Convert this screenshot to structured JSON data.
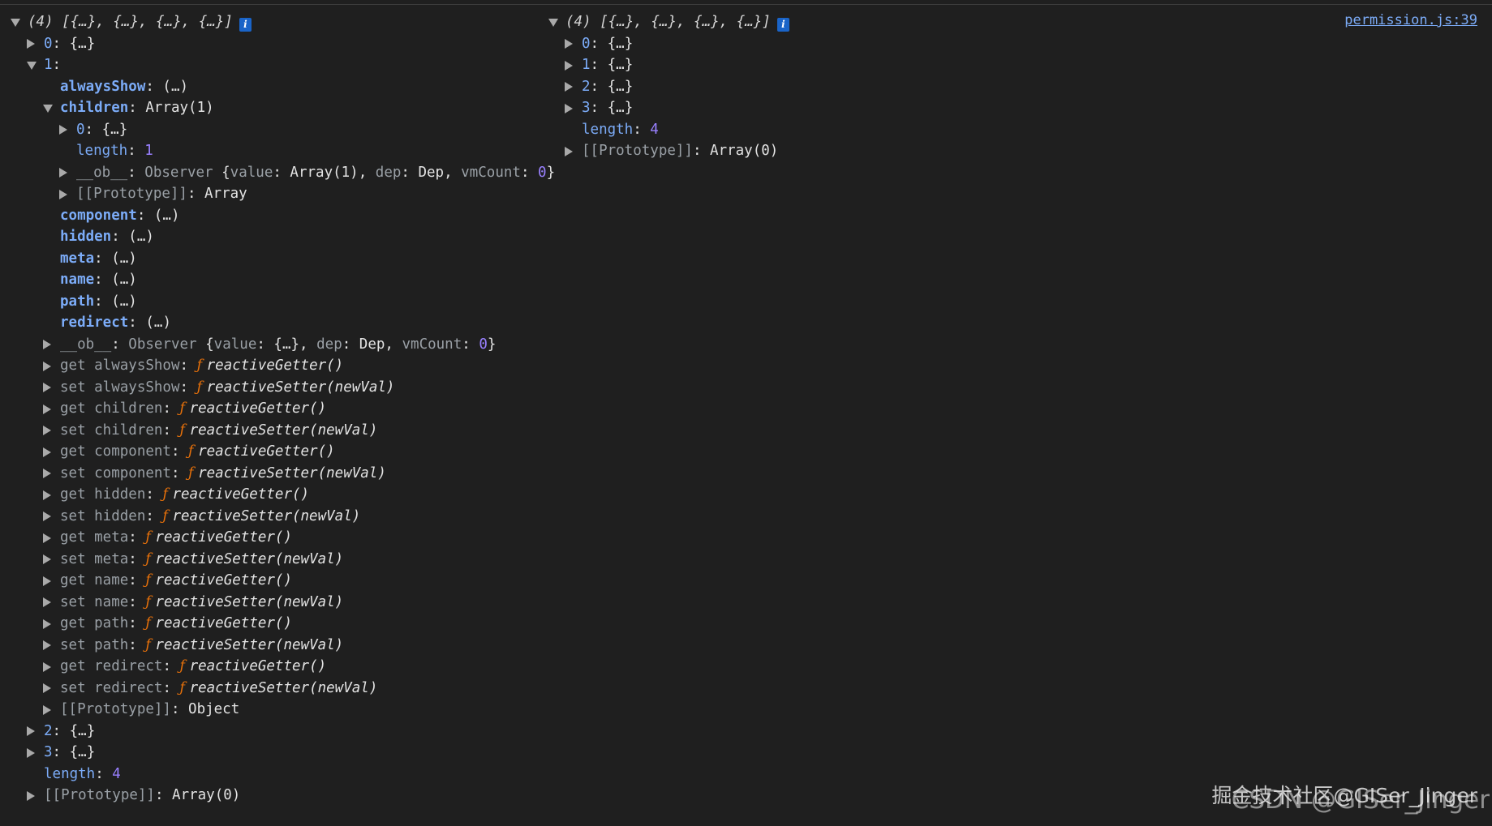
{
  "console": {
    "source_link": "permission.js:39",
    "watermark_primary": "掘金技术社区@GISer_Jinger",
    "watermark_secondary": "CSDN @GISer_Jinger",
    "left_tree": [
      {
        "indent": 0,
        "toggle": "down",
        "parts": [
          {
            "t": "(4)  [{…}, {…}, {…}, {…}]",
            "c": "sum"
          }
        ],
        "info": true
      },
      {
        "indent": 1,
        "toggle": "right",
        "parts": [
          {
            "t": "0",
            "c": "k"
          },
          {
            "t": ": {…}",
            "c": "val"
          }
        ]
      },
      {
        "indent": 1,
        "toggle": "down",
        "parts": [
          {
            "t": "1",
            "c": "k"
          },
          {
            "t": ":",
            "c": "val"
          }
        ]
      },
      {
        "indent": 2,
        "toggle": "none",
        "parts": [
          {
            "t": "alwaysShow",
            "c": "kb"
          },
          {
            "t": ":  (…)",
            "c": "val"
          }
        ]
      },
      {
        "indent": 2,
        "toggle": "down",
        "parts": [
          {
            "t": "children",
            "c": "kb"
          },
          {
            "t": ": Array(1)",
            "c": "val"
          }
        ]
      },
      {
        "indent": 3,
        "toggle": "right",
        "parts": [
          {
            "t": "0",
            "c": "k"
          },
          {
            "t": ": {…}",
            "c": "val"
          }
        ]
      },
      {
        "indent": 3,
        "toggle": "none",
        "parts": [
          {
            "t": "length",
            "c": "k"
          },
          {
            "t": ": ",
            "c": "val"
          },
          {
            "t": "1",
            "c": "num"
          }
        ]
      },
      {
        "indent": 3,
        "toggle": "right",
        "parts": [
          {
            "t": "__ob__",
            "c": "kd"
          },
          {
            "t": ": ",
            "c": "val"
          },
          {
            "t": "Observer  ",
            "c": "kd"
          },
          {
            "t": "{",
            "c": "val"
          },
          {
            "t": "value",
            "c": "kd"
          },
          {
            "t": ": Array(1), ",
            "c": "val"
          },
          {
            "t": "dep",
            "c": "kd"
          },
          {
            "t": ": Dep, ",
            "c": "val"
          },
          {
            "t": "vmCount",
            "c": "kd"
          },
          {
            "t": ": ",
            "c": "val"
          },
          {
            "t": "0",
            "c": "num"
          },
          {
            "t": "}",
            "c": "val"
          }
        ]
      },
      {
        "indent": 3,
        "toggle": "right",
        "parts": [
          {
            "t": "[[Prototype]]",
            "c": "kd"
          },
          {
            "t": ": Array",
            "c": "val"
          }
        ]
      },
      {
        "indent": 2,
        "toggle": "none",
        "parts": [
          {
            "t": "component",
            "c": "kb"
          },
          {
            "t": ":  (…)",
            "c": "val"
          }
        ]
      },
      {
        "indent": 2,
        "toggle": "none",
        "parts": [
          {
            "t": "hidden",
            "c": "kb"
          },
          {
            "t": ":  (…)",
            "c": "val"
          }
        ]
      },
      {
        "indent": 2,
        "toggle": "none",
        "parts": [
          {
            "t": "meta",
            "c": "kb"
          },
          {
            "t": ":  (…)",
            "c": "val"
          }
        ]
      },
      {
        "indent": 2,
        "toggle": "none",
        "parts": [
          {
            "t": "name",
            "c": "kb"
          },
          {
            "t": ":  (…)",
            "c": "val"
          }
        ]
      },
      {
        "indent": 2,
        "toggle": "none",
        "parts": [
          {
            "t": "path",
            "c": "kb"
          },
          {
            "t": ":  (…)",
            "c": "val"
          }
        ]
      },
      {
        "indent": 2,
        "toggle": "none",
        "parts": [
          {
            "t": "redirect",
            "c": "kb"
          },
          {
            "t": ":  (…)",
            "c": "val"
          }
        ]
      },
      {
        "indent": 2,
        "toggle": "right",
        "parts": [
          {
            "t": "__ob__",
            "c": "kd"
          },
          {
            "t": ": ",
            "c": "val"
          },
          {
            "t": "Observer  ",
            "c": "kd"
          },
          {
            "t": "{",
            "c": "val"
          },
          {
            "t": "value",
            "c": "kd"
          },
          {
            "t": ": {…}, ",
            "c": "val"
          },
          {
            "t": "dep",
            "c": "kd"
          },
          {
            "t": ": Dep, ",
            "c": "val"
          },
          {
            "t": "vmCount",
            "c": "kd"
          },
          {
            "t": ": ",
            "c": "val"
          },
          {
            "t": "0",
            "c": "num"
          },
          {
            "t": "}",
            "c": "val"
          }
        ]
      },
      {
        "indent": 2,
        "toggle": "right",
        "parts": [
          {
            "t": "get alwaysShow",
            "c": "kd"
          },
          {
            "t": ": ",
            "c": "val"
          },
          {
            "t": "ƒ ",
            "c": "f"
          },
          {
            "t": "reactiveGetter()",
            "c": "fn"
          }
        ]
      },
      {
        "indent": 2,
        "toggle": "right",
        "parts": [
          {
            "t": "set alwaysShow",
            "c": "kd"
          },
          {
            "t": ": ",
            "c": "val"
          },
          {
            "t": "ƒ ",
            "c": "f"
          },
          {
            "t": "reactiveSetter(newVal)",
            "c": "fn"
          }
        ]
      },
      {
        "indent": 2,
        "toggle": "right",
        "parts": [
          {
            "t": "get children",
            "c": "kd"
          },
          {
            "t": ": ",
            "c": "val"
          },
          {
            "t": "ƒ ",
            "c": "f"
          },
          {
            "t": "reactiveGetter()",
            "c": "fn"
          }
        ]
      },
      {
        "indent": 2,
        "toggle": "right",
        "parts": [
          {
            "t": "set children",
            "c": "kd"
          },
          {
            "t": ": ",
            "c": "val"
          },
          {
            "t": "ƒ ",
            "c": "f"
          },
          {
            "t": "reactiveSetter(newVal)",
            "c": "fn"
          }
        ]
      },
      {
        "indent": 2,
        "toggle": "right",
        "parts": [
          {
            "t": "get component",
            "c": "kd"
          },
          {
            "t": ": ",
            "c": "val"
          },
          {
            "t": "ƒ ",
            "c": "f"
          },
          {
            "t": "reactiveGetter()",
            "c": "fn"
          }
        ]
      },
      {
        "indent": 2,
        "toggle": "right",
        "parts": [
          {
            "t": "set component",
            "c": "kd"
          },
          {
            "t": ": ",
            "c": "val"
          },
          {
            "t": "ƒ ",
            "c": "f"
          },
          {
            "t": "reactiveSetter(newVal)",
            "c": "fn"
          }
        ]
      },
      {
        "indent": 2,
        "toggle": "right",
        "parts": [
          {
            "t": "get hidden",
            "c": "kd"
          },
          {
            "t": ": ",
            "c": "val"
          },
          {
            "t": "ƒ ",
            "c": "f"
          },
          {
            "t": "reactiveGetter()",
            "c": "fn"
          }
        ]
      },
      {
        "indent": 2,
        "toggle": "right",
        "parts": [
          {
            "t": "set hidden",
            "c": "kd"
          },
          {
            "t": ": ",
            "c": "val"
          },
          {
            "t": "ƒ ",
            "c": "f"
          },
          {
            "t": "reactiveSetter(newVal)",
            "c": "fn"
          }
        ]
      },
      {
        "indent": 2,
        "toggle": "right",
        "parts": [
          {
            "t": "get meta",
            "c": "kd"
          },
          {
            "t": ": ",
            "c": "val"
          },
          {
            "t": "ƒ ",
            "c": "f"
          },
          {
            "t": "reactiveGetter()",
            "c": "fn"
          }
        ]
      },
      {
        "indent": 2,
        "toggle": "right",
        "parts": [
          {
            "t": "set meta",
            "c": "kd"
          },
          {
            "t": ": ",
            "c": "val"
          },
          {
            "t": "ƒ ",
            "c": "f"
          },
          {
            "t": "reactiveSetter(newVal)",
            "c": "fn"
          }
        ]
      },
      {
        "indent": 2,
        "toggle": "right",
        "parts": [
          {
            "t": "get name",
            "c": "kd"
          },
          {
            "t": ": ",
            "c": "val"
          },
          {
            "t": "ƒ ",
            "c": "f"
          },
          {
            "t": "reactiveGetter()",
            "c": "fn"
          }
        ]
      },
      {
        "indent": 2,
        "toggle": "right",
        "parts": [
          {
            "t": "set name",
            "c": "kd"
          },
          {
            "t": ": ",
            "c": "val"
          },
          {
            "t": "ƒ ",
            "c": "f"
          },
          {
            "t": "reactiveSetter(newVal)",
            "c": "fn"
          }
        ]
      },
      {
        "indent": 2,
        "toggle": "right",
        "parts": [
          {
            "t": "get path",
            "c": "kd"
          },
          {
            "t": ": ",
            "c": "val"
          },
          {
            "t": "ƒ ",
            "c": "f"
          },
          {
            "t": "reactiveGetter()",
            "c": "fn"
          }
        ]
      },
      {
        "indent": 2,
        "toggle": "right",
        "parts": [
          {
            "t": "set path",
            "c": "kd"
          },
          {
            "t": ": ",
            "c": "val"
          },
          {
            "t": "ƒ ",
            "c": "f"
          },
          {
            "t": "reactiveSetter(newVal)",
            "c": "fn"
          }
        ]
      },
      {
        "indent": 2,
        "toggle": "right",
        "parts": [
          {
            "t": "get redirect",
            "c": "kd"
          },
          {
            "t": ": ",
            "c": "val"
          },
          {
            "t": "ƒ ",
            "c": "f"
          },
          {
            "t": "reactiveGetter()",
            "c": "fn"
          }
        ]
      },
      {
        "indent": 2,
        "toggle": "right",
        "parts": [
          {
            "t": "set redirect",
            "c": "kd"
          },
          {
            "t": ": ",
            "c": "val"
          },
          {
            "t": "ƒ ",
            "c": "f"
          },
          {
            "t": "reactiveSetter(newVal)",
            "c": "fn"
          }
        ]
      },
      {
        "indent": 2,
        "toggle": "right",
        "parts": [
          {
            "t": "[[Prototype]]",
            "c": "kd"
          },
          {
            "t": ": Object",
            "c": "val"
          }
        ]
      },
      {
        "indent": 1,
        "toggle": "right",
        "parts": [
          {
            "t": "2",
            "c": "k"
          },
          {
            "t": ": {…}",
            "c": "val"
          }
        ]
      },
      {
        "indent": 1,
        "toggle": "right",
        "parts": [
          {
            "t": "3",
            "c": "k"
          },
          {
            "t": ": {…}",
            "c": "val"
          }
        ]
      },
      {
        "indent": 1,
        "toggle": "none",
        "parts": [
          {
            "t": "length",
            "c": "k"
          },
          {
            "t": ": ",
            "c": "val"
          },
          {
            "t": "4",
            "c": "num"
          }
        ]
      },
      {
        "indent": 1,
        "toggle": "right",
        "parts": [
          {
            "t": "[[Prototype]]",
            "c": "kd"
          },
          {
            "t": ": Array(0)",
            "c": "val"
          }
        ]
      }
    ],
    "right_tree": [
      {
        "indent": 0,
        "toggle": "down",
        "parts": [
          {
            "t": "(4)  [{…}, {…}, {…}, {…}]",
            "c": "sum"
          }
        ],
        "info": true
      },
      {
        "indent": 1,
        "toggle": "right",
        "parts": [
          {
            "t": "0",
            "c": "k"
          },
          {
            "t": ": {…}",
            "c": "val"
          }
        ]
      },
      {
        "indent": 1,
        "toggle": "right",
        "parts": [
          {
            "t": "1",
            "c": "k"
          },
          {
            "t": ": {…}",
            "c": "val"
          }
        ]
      },
      {
        "indent": 1,
        "toggle": "right",
        "parts": [
          {
            "t": "2",
            "c": "k"
          },
          {
            "t": ": {…}",
            "c": "val"
          }
        ]
      },
      {
        "indent": 1,
        "toggle": "right",
        "parts": [
          {
            "t": "3",
            "c": "k"
          },
          {
            "t": ": {…}",
            "c": "val"
          }
        ]
      },
      {
        "indent": 1,
        "toggle": "none",
        "parts": [
          {
            "t": "length",
            "c": "k"
          },
          {
            "t": ": ",
            "c": "val"
          },
          {
            "t": "4",
            "c": "num"
          }
        ]
      },
      {
        "indent": 1,
        "toggle": "right",
        "parts": [
          {
            "t": "[[Prototype]]",
            "c": "kd"
          },
          {
            "t": ": Array(0)",
            "c": "val"
          }
        ]
      }
    ]
  }
}
